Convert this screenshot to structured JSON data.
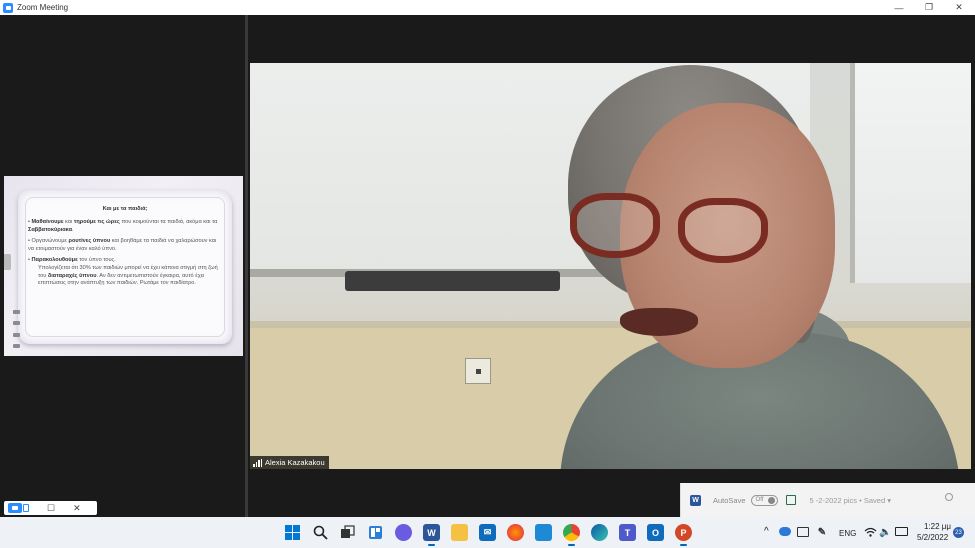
{
  "window": {
    "title": "Zoom Meeting",
    "controls": {
      "minimize": "—",
      "restore": "❐",
      "close": "✕"
    }
  },
  "slide": {
    "title": "Και με τα παιδιά;",
    "bullet1": {
      "pre": "• ",
      "b1": "Μαθαίνουμε",
      "t1": " και ",
      "b2": "τηρούμε τις ώρες",
      "t2": " που κοιμούνται τα παιδιά, ακόμα και τα ",
      "b3": "Σαββατοκύριακα",
      "t3": "."
    },
    "bullet2": {
      "pre": "• Οργανώνουμε ",
      "b1": "ρουτίνες ύπνου",
      "t1": " και βοηθάμε τα παιδιά να χαλαρώσουν και να ετοιμαστούν για έναν καλό ύπνο."
    },
    "bullet3": {
      "pre": "• ",
      "b1": "Παρακολουθούμε",
      "t1": " τον ύπνο τους.",
      "sub_pre": "Υπολογίζεται ότι  30% των παιδιών μπορεί να έχει κάποια στιγμή στη ζωή του ",
      "sub_b": "διαταραχές ύπνου",
      "sub_post": ". Αν δεν αντιμετωπιστούν έγκαιρα, αυτό έχει επιπτώσεις στην ανάπτυξη των παιδιών. Ρωτάμε τον παιδίατρο."
    }
  },
  "video": {
    "participant_name": "Alexia Kazakakou"
  },
  "mini_toolbar": {
    "restore": "☐",
    "close": "✕"
  },
  "word_toast": {
    "app_letter": "W",
    "autosave_label": "AutoSave",
    "toggle_state": "Off",
    "document": "5 -2-2022 pics • Saved ▾"
  },
  "taskbar": {
    "apps": [
      "start",
      "search",
      "task-view",
      "widgets",
      "chat",
      "word",
      "file-explorer",
      "mail",
      "firefox",
      "snipping",
      "chrome",
      "edge",
      "teams",
      "outlook",
      "powerpoint"
    ],
    "tray": {
      "chevron": "^",
      "language": "ENG",
      "time": "1:22 μμ",
      "date": "5/2/2022",
      "notifications": "23"
    }
  }
}
